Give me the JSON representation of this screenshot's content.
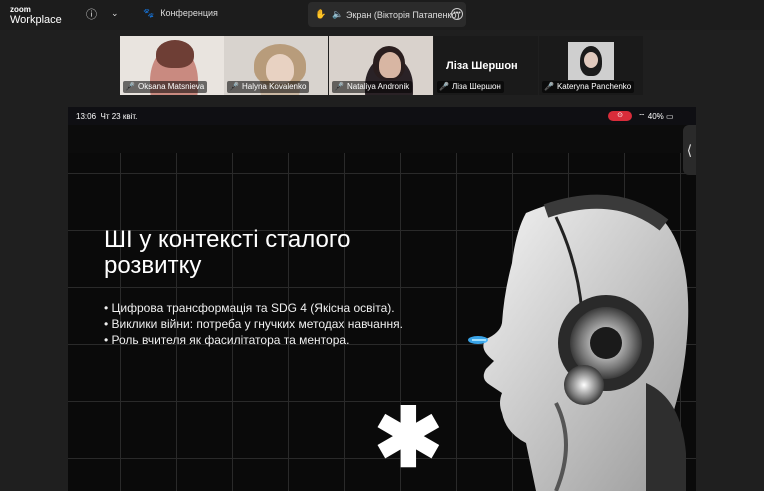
{
  "app": {
    "logo_line1": "zoom",
    "logo_line2": "Workplace"
  },
  "toolbar": {
    "conference_label": "Конференция",
    "share_title": "Экран (Вікторія Патапенко)"
  },
  "participants": [
    {
      "name": "Oksana Matsnieva",
      "muted": true
    },
    {
      "name": "Halyna Kovalenko",
      "muted": true
    },
    {
      "name": "Nataliya Andronik",
      "muted": true
    },
    {
      "name": "Ліза Шершон",
      "muted": true,
      "display_title": "Ліза Шершон"
    },
    {
      "name": "Kateryna Panchenko",
      "muted": true
    }
  ],
  "device_status": {
    "time": "13:06",
    "date": "Чт 23 квіт.",
    "battery": "40%"
  },
  "slide": {
    "title": "ШІ у контексті сталого розвитку",
    "bullets": [
      "• Цифрова трансформація та SDG 4 (Якісна освіта).",
      "• Виклики війни: потреба у гнучких методах навчання.",
      "• Роль вчителя як фасилітатора та ментора."
    ]
  },
  "colors": {
    "accent_record": "#d92c3a",
    "mic_muted": "#e04848",
    "eye_glow": "#3fb5ff"
  },
  "icons": [
    "info-icon",
    "chevron-down-icon",
    "participants-icon",
    "hand-icon",
    "speaker-icon",
    "more-icon",
    "mic-off-icon",
    "wifi-icon",
    "battery-icon",
    "collapse-handle-icon"
  ]
}
